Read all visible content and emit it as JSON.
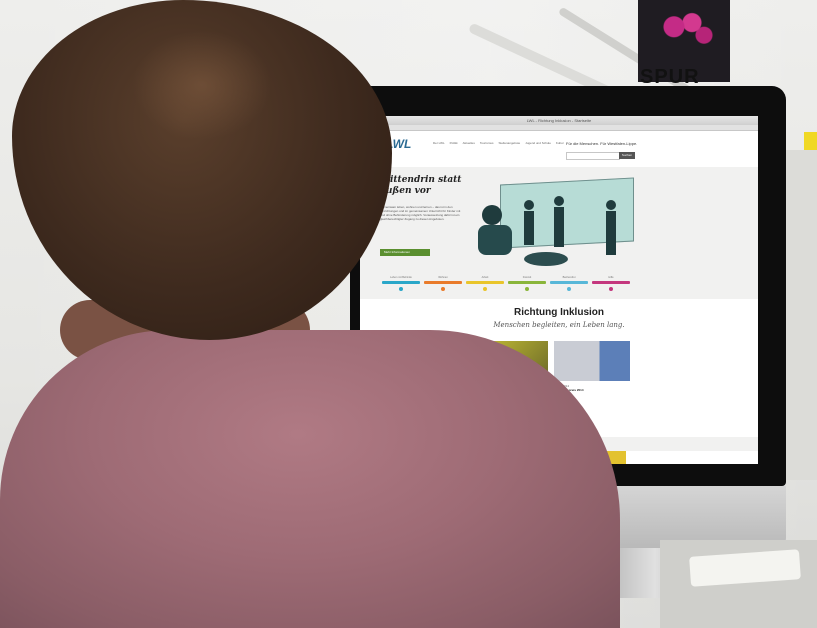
{
  "background": {
    "poster_text": "SPUR"
  },
  "browser": {
    "title": "LWL - Richtung Inklusion - Startseite"
  },
  "site": {
    "logo": "LWL",
    "nav": [
      "Der LWL",
      "Politik",
      "Aktuelles",
      "Tourismus",
      "Stellenangebote",
      "Jugend und Schule",
      "Kultur"
    ],
    "tagline": "Für die Menschen. Für Westfalen-Lippe.",
    "search_button": "Suchen",
    "hero": {
      "title_line1": "Mittendrin statt",
      "title_line2": "außen vor",
      "text": "Gemeinsam leben, wohnen und lernen – das ist in den Einrichtungen und im gemeinsamen Unterricht für Kinder mit und ohne Behinderung möglich. Voraussetzung dafür ist ein gleichberechtigter Zugang zu diesen Angeboten.",
      "button": "Mehr Informationen"
    },
    "steps": [
      {
        "label": "Leben mit Behinde",
        "color": "#2aa7c9"
      },
      {
        "label": "Wohnen",
        "color": "#e97b2b"
      },
      {
        "label": "Arbeit",
        "color": "#e9c52b"
      },
      {
        "label": "Freizeit",
        "color": "#8ab53a"
      },
      {
        "label": "Barrierefrei",
        "color": "#57b7d8"
      },
      {
        "label": "Hilfe",
        "color": "#c4377e"
      }
    ],
    "section_title": "Richtung Inklusion",
    "section_sub": "Menschen begleiten, ein Leben lang.",
    "news": [
      {
        "date": "",
        "headline": ""
      },
      {
        "date": "11.08.2014",
        "headline": "Die Arbeitslosigkeit von Menschen mit Schwerbehinderung bleibt hoch"
      },
      {
        "date": "02.06.2014",
        "headline": "Inklusionspreis 2014"
      }
    ]
  },
  "colors": {
    "accent": "#2b6a92",
    "button_green": "#5a8f2f",
    "shirt": "#9e6b75",
    "hair": "#3e2a1e"
  }
}
